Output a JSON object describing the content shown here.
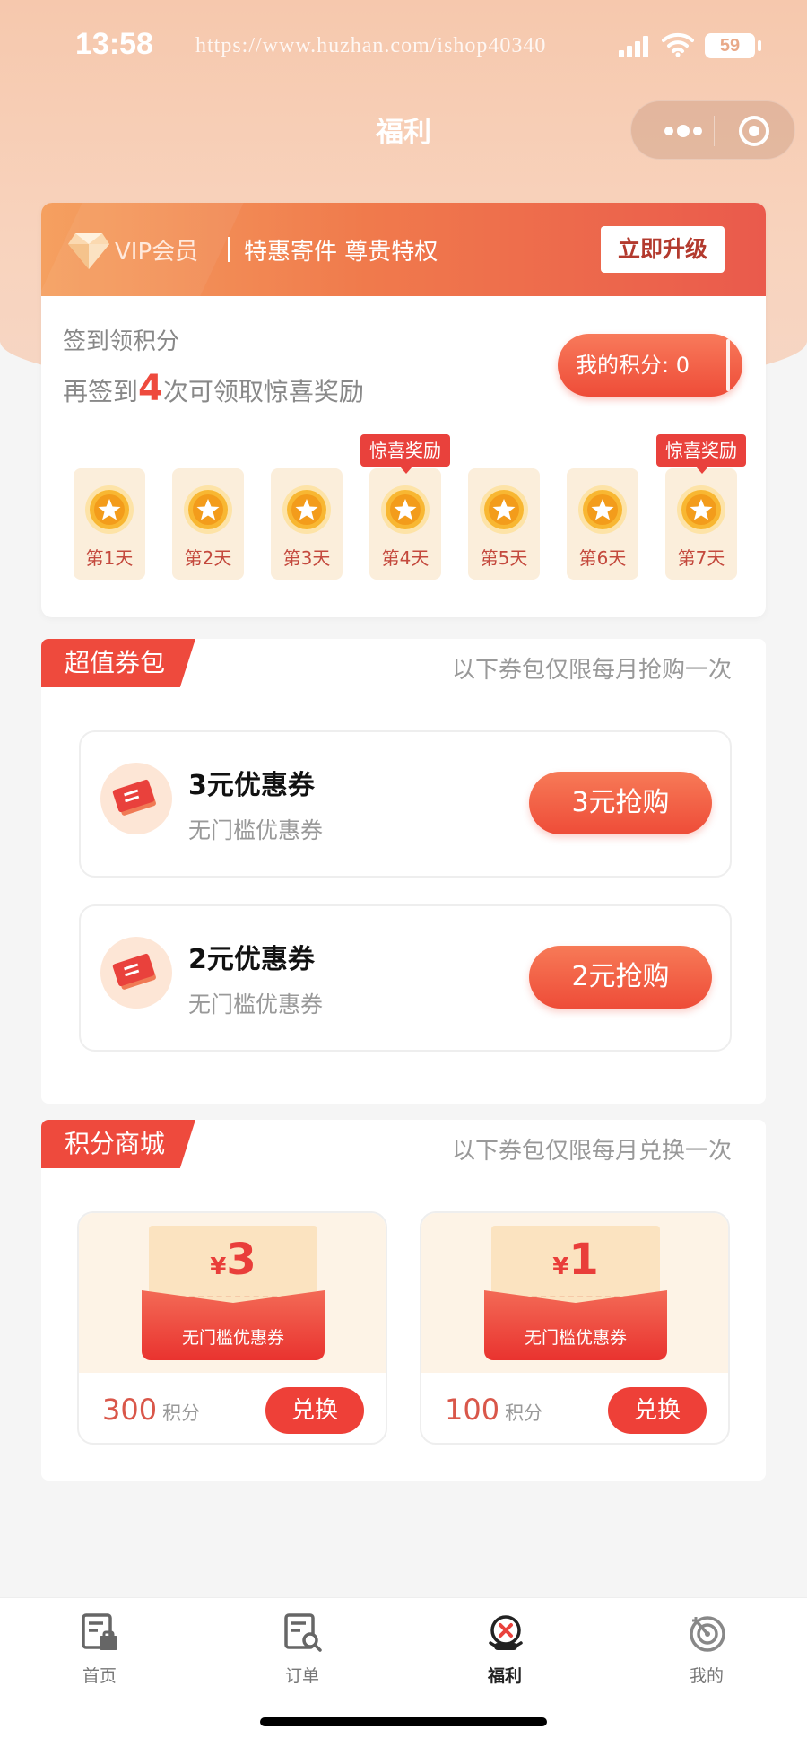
{
  "status_bar": {
    "time": "13:58",
    "watermark": "https://www.huzhan.com/ishop40340",
    "battery": "59"
  },
  "nav": {
    "title": "福利"
  },
  "vip": {
    "label": "VIP会员",
    "slogan": "特惠寄件 尊贵特权",
    "upgrade_label": "立即升级"
  },
  "sign": {
    "title": "签到领积分",
    "remaining_prefix": "再签到",
    "remaining_count": "4",
    "remaining_suffix": "次可领取惊喜奖励",
    "points_label": "我的积分: 0",
    "surprise_label": "惊喜奖励",
    "days": [
      {
        "label": "第1天",
        "surprise": false
      },
      {
        "label": "第2天",
        "surprise": false
      },
      {
        "label": "第3天",
        "surprise": false
      },
      {
        "label": "第4天",
        "surprise": true
      },
      {
        "label": "第5天",
        "surprise": false
      },
      {
        "label": "第6天",
        "surprise": false
      },
      {
        "label": "第7天",
        "surprise": true
      }
    ]
  },
  "coupon_pack": {
    "tag": "超值券包",
    "note": "以下券包仅限每月抢购一次",
    "items": [
      {
        "title": "3元优惠券",
        "subtitle": "无门槛优惠券",
        "button": "3元抢购"
      },
      {
        "title": "2元优惠券",
        "subtitle": "无门槛优惠券",
        "button": "2元抢购"
      }
    ]
  },
  "points_mall": {
    "tag": "积分商城",
    "note": "以下券包仅限每月兑换一次",
    "items": [
      {
        "currency": "¥",
        "amount": "3",
        "label": "无门槛优惠券",
        "points": "300",
        "unit": "积分",
        "button": "兑换"
      },
      {
        "currency": "¥",
        "amount": "1",
        "label": "无门槛优惠券",
        "points": "100",
        "unit": "积分",
        "button": "兑换"
      }
    ]
  },
  "tabbar": {
    "items": [
      {
        "label": "首页",
        "icon": "home-icon",
        "active": false
      },
      {
        "label": "订单",
        "icon": "order-search-icon",
        "active": false
      },
      {
        "label": "福利",
        "icon": "welfare-icon",
        "active": true
      },
      {
        "label": "我的",
        "icon": "target-icon",
        "active": false
      }
    ]
  },
  "colors": {
    "accent": "#ee4a3d",
    "header_bg": "#f6c8ad",
    "vip_gradient_start": "#f5a060",
    "vip_gradient_end": "#ea5a4c"
  }
}
